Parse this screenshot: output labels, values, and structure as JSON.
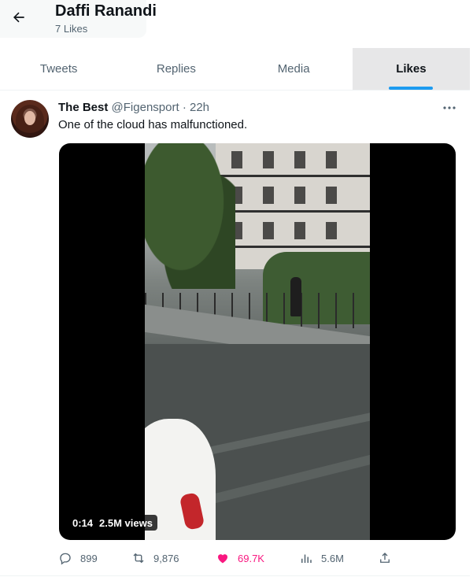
{
  "header": {
    "name": "Daffi Ranandi",
    "likes_label": "7 Likes"
  },
  "tabs": [
    {
      "label": "Tweets",
      "active": false
    },
    {
      "label": "Replies",
      "active": false
    },
    {
      "label": "Media",
      "active": false
    },
    {
      "label": "Likes",
      "active": true
    }
  ],
  "tweet": {
    "author_name": "The Best",
    "handle": "@Figensport",
    "separator": "·",
    "time": "22h",
    "text": "One of the cloud has malfunctioned.",
    "video": {
      "duration": "0:14",
      "views": "2.5M views"
    },
    "actions": {
      "replies": "899",
      "retweets": "9,876",
      "likes": "69.7K",
      "views": "5.6M"
    }
  },
  "colors": {
    "accent": "#1d9bf0",
    "like": "#f91880",
    "muted": "#536471",
    "text": "#0f1419"
  },
  "icons": {
    "back": "arrow-left-icon",
    "more": "more-dots-icon",
    "reply": "reply-icon",
    "retweet": "retweet-icon",
    "like": "heart-icon",
    "views": "analytics-icon",
    "share": "share-icon"
  }
}
